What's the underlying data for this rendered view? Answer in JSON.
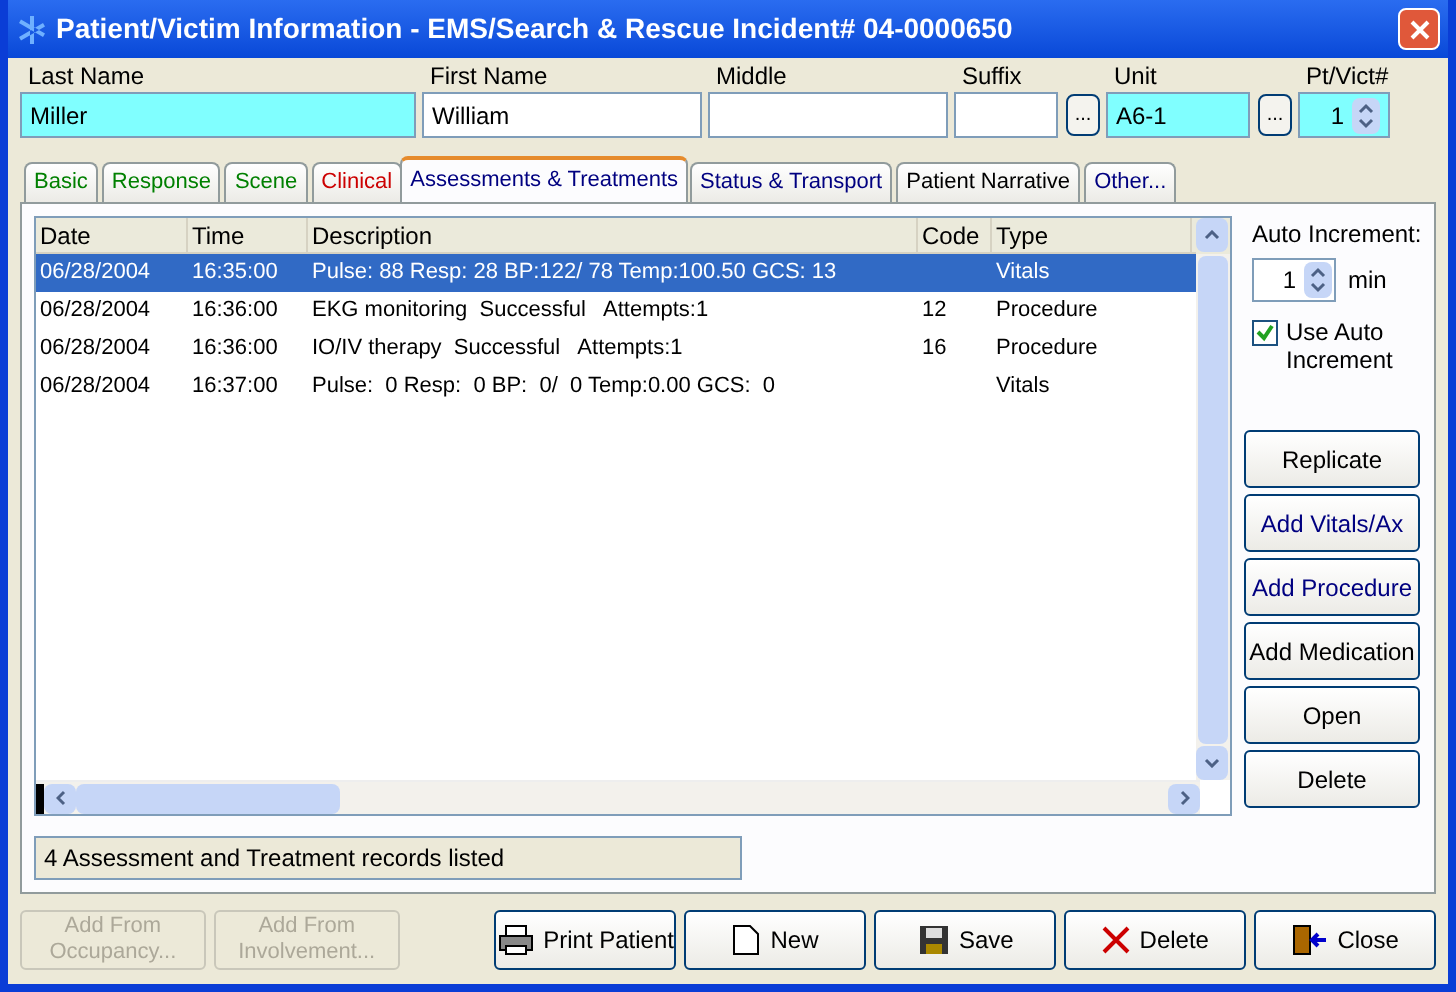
{
  "window": {
    "title": "Patient/Victim Information - EMS/Search & Rescue Incident# 04-0000650"
  },
  "fields": [
    {
      "label": "Last Name",
      "value": "Miller",
      "required": true,
      "kind": "text"
    },
    {
      "label": "First Name",
      "value": "William",
      "required": false,
      "kind": "text"
    },
    {
      "label": "Middle",
      "required": false,
      "kind": "text"
    },
    {
      "label": "Suffix",
      "required": false,
      "kind": "lookup",
      "button": "..."
    },
    {
      "label": "Unit",
      "value": "A6-1",
      "required": true,
      "kind": "lookup",
      "button": "..."
    },
    {
      "label": "Pt/Vict#",
      "value": "1",
      "required": true,
      "kind": "spin"
    }
  ],
  "tabs": [
    {
      "label": "Basic",
      "selected": false,
      "color": "#008000"
    },
    {
      "label": "Response",
      "selected": false,
      "color": "#008000"
    },
    {
      "label": "Scene",
      "selected": false,
      "color": "#008000"
    },
    {
      "label": "Clinical",
      "selected": false,
      "color": "#cc0000"
    },
    {
      "label": "Assessments & Treatments",
      "selected": true,
      "color": "#000080"
    },
    {
      "label": "Status & Transport",
      "selected": false,
      "color": "#000080"
    },
    {
      "label": "Patient Narrative",
      "selected": false,
      "color": "#000000"
    },
    {
      "label": "Other...",
      "selected": false,
      "color": "#000080"
    }
  ],
  "table": {
    "columns": [
      "Date",
      "Time",
      "Description",
      "Code",
      "Type"
    ],
    "rows": [
      {
        "cells": [
          "06/28/2004",
          "16:35:00",
          "Pulse: 88 Resp: 28 BP:122/ 78 Temp:100.50 GCS: 13",
          "",
          "Vitals"
        ],
        "selected": true
      },
      {
        "cells": [
          "06/28/2004",
          "16:36:00",
          "EKG monitoring  Successful   Attempts:1",
          "12",
          "Procedure"
        ],
        "selected": false
      },
      {
        "cells": [
          "06/28/2004",
          "16:36:00",
          "IO/IV therapy  Successful   Attempts:1",
          "16",
          "Procedure"
        ],
        "selected": false
      },
      {
        "cells": [
          "06/28/2004",
          "16:37:00",
          "Pulse:  0 Resp:  0 BP:  0/  0 Temp:0.00 GCS:  0",
          "",
          "Vitals"
        ],
        "selected": false
      }
    ]
  },
  "status": "4 Assessment and Treatment records listed",
  "auto_increment": {
    "label": "Auto Increment:",
    "value": "1",
    "unit": "min",
    "checkbox_label": "Use Auto Increment",
    "checked": true
  },
  "side_buttons": [
    {
      "label": "Replicate",
      "color": "#000000"
    },
    {
      "label": "Add Vitals/Ax",
      "color": "#000080"
    },
    {
      "label": "Add Procedure",
      "color": "#000080"
    },
    {
      "label": "Add Medication",
      "color": "#000000"
    },
    {
      "label": "Open",
      "color": "#000000"
    },
    {
      "label": "Delete",
      "color": "#000000"
    }
  ],
  "left_buttons": [
    {
      "label": "Add From Occupancy...",
      "disabled": true
    },
    {
      "label": "Add From Involvement...",
      "disabled": true
    }
  ],
  "bottom_buttons": [
    {
      "label": "Print Patient",
      "kind": "print"
    },
    {
      "label": "New",
      "kind": "new"
    },
    {
      "label": "Save",
      "kind": "save"
    },
    {
      "label": "Delete",
      "kind": "delete"
    },
    {
      "label": "Close",
      "kind": "close"
    }
  ]
}
